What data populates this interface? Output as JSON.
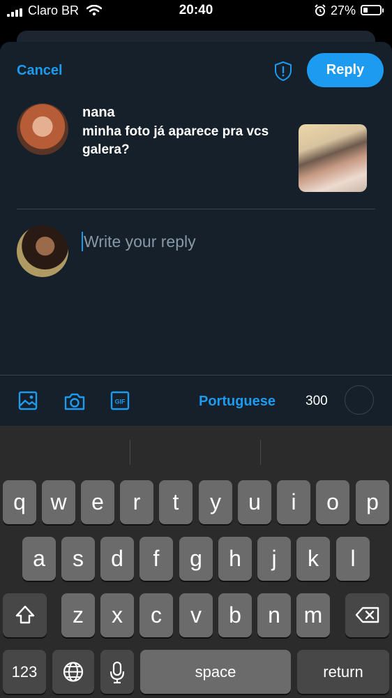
{
  "status_bar": {
    "carrier": "Claro BR",
    "time": "20:40",
    "battery": "27%"
  },
  "composer": {
    "cancel_label": "Cancel",
    "reply_label": "Reply",
    "tweet": {
      "author": "nana",
      "text": "minha foto já aparece pra vcs galera?"
    },
    "reply_placeholder": "Write your reply"
  },
  "toolbar": {
    "language": "Portuguese",
    "char_count": "300"
  },
  "keyboard": {
    "row1": [
      "q",
      "w",
      "e",
      "r",
      "t",
      "y",
      "u",
      "i",
      "o",
      "p"
    ],
    "row2": [
      "a",
      "s",
      "d",
      "f",
      "g",
      "h",
      "j",
      "k",
      "l"
    ],
    "row3": [
      "z",
      "x",
      "c",
      "v",
      "b",
      "n",
      "m"
    ],
    "numbers_label": "123",
    "space_label": "space",
    "return_label": "return"
  },
  "colors": {
    "accent": "#1d9bf0",
    "background": "#15202b",
    "divider": "#38444d"
  },
  "icons": [
    "signal-icon",
    "wifi-icon",
    "alarm-icon",
    "battery-icon",
    "shield-icon",
    "image-icon",
    "camera-icon",
    "gif-icon",
    "shift-icon",
    "backspace-icon",
    "globe-icon",
    "mic-icon"
  ]
}
